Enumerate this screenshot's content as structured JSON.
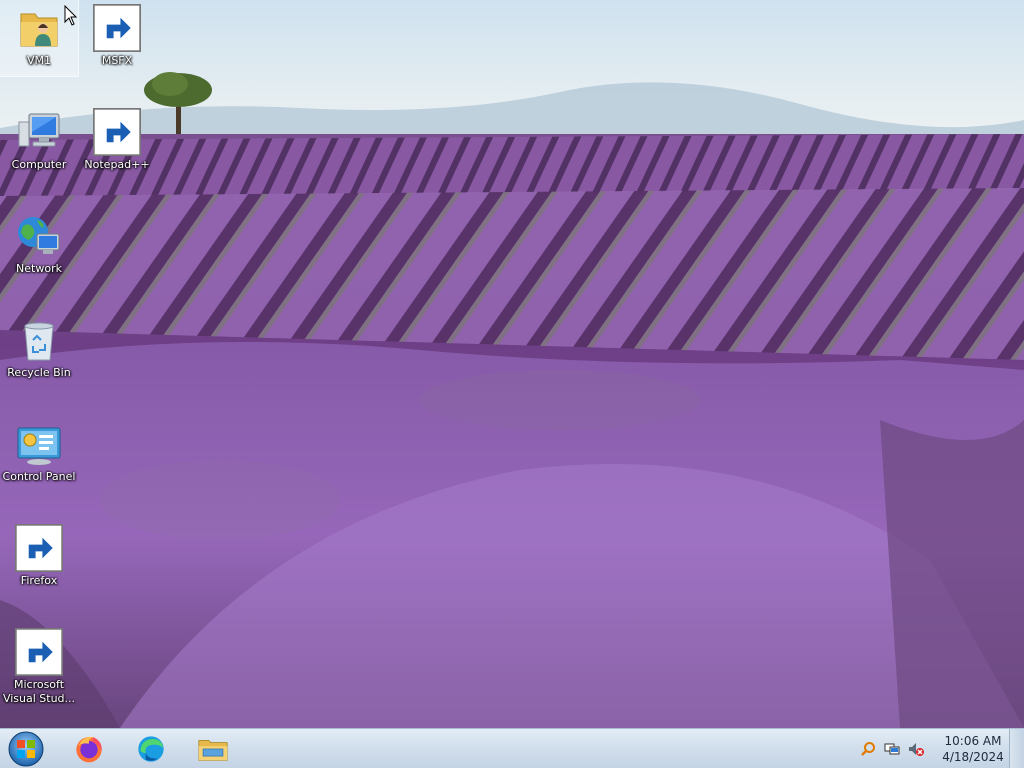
{
  "desktop": {
    "icons": [
      {
        "label": "VM1",
        "icon": "folder-user-icon",
        "shortcut": false,
        "selected": true
      },
      {
        "label": "MSFX",
        "icon": "firefox-icon",
        "shortcut": true,
        "selected": false
      },
      {
        "label": "Computer",
        "icon": "computer-icon",
        "shortcut": false,
        "selected": false
      },
      {
        "label": "Notepad++",
        "icon": "notepad-plus-plus-icon",
        "shortcut": true,
        "selected": false
      },
      {
        "label": "Network",
        "icon": "network-icon",
        "shortcut": false,
        "selected": false
      },
      {
        "label": "Recycle Bin",
        "icon": "recycle-bin-icon",
        "shortcut": false,
        "selected": false
      },
      {
        "label": "Control Panel",
        "icon": "control-panel-icon",
        "shortcut": false,
        "selected": false
      },
      {
        "label": "Firefox",
        "icon": "firefox-icon",
        "shortcut": true,
        "selected": false
      },
      {
        "label": "Microsoft Visual Stud...",
        "icon": "visual-studio-icon",
        "shortcut": true,
        "selected": false
      }
    ]
  },
  "taskbar": {
    "start_button": "start-orb-icon",
    "pinned": [
      {
        "app": "Firefox",
        "icon": "firefox-icon"
      },
      {
        "app": "Edge",
        "icon": "edge-icon"
      },
      {
        "app": "File Explorer",
        "icon": "file-explorer-icon"
      }
    ],
    "tray": {
      "icons": [
        "search-icon",
        "network-tray-icon",
        "volume-muted-icon"
      ],
      "time": "10:06 AM",
      "date": "4/18/2024"
    }
  },
  "colors": {
    "sky_top": "#cfe2ef",
    "sky_bottom": "#e9eef0",
    "lavender_dark": "#5a3a6e",
    "lavender": "#8a5fa8",
    "lavender_light": "#b68fd0",
    "taskbar": "#d2dfec"
  }
}
